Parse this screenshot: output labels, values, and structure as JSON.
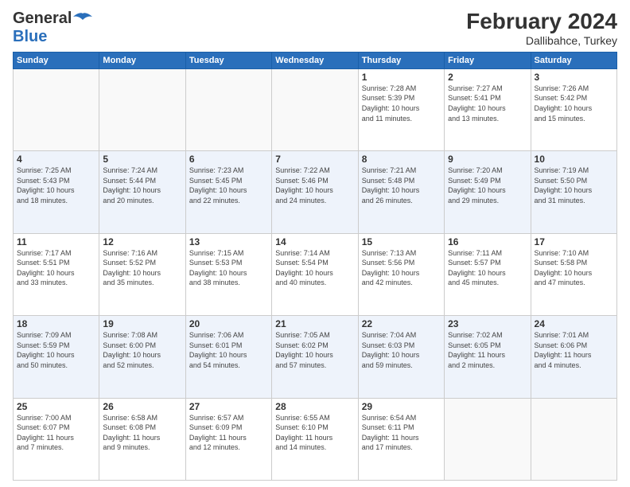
{
  "header": {
    "logo_general": "General",
    "logo_blue": "Blue",
    "month_year": "February 2024",
    "location": "Dallibahce, Turkey"
  },
  "days_of_week": [
    "Sunday",
    "Monday",
    "Tuesday",
    "Wednesday",
    "Thursday",
    "Friday",
    "Saturday"
  ],
  "weeks": [
    [
      {
        "day": "",
        "info": ""
      },
      {
        "day": "",
        "info": ""
      },
      {
        "day": "",
        "info": ""
      },
      {
        "day": "",
        "info": ""
      },
      {
        "day": "1",
        "info": "Sunrise: 7:28 AM\nSunset: 5:39 PM\nDaylight: 10 hours\nand 11 minutes."
      },
      {
        "day": "2",
        "info": "Sunrise: 7:27 AM\nSunset: 5:41 PM\nDaylight: 10 hours\nand 13 minutes."
      },
      {
        "day": "3",
        "info": "Sunrise: 7:26 AM\nSunset: 5:42 PM\nDaylight: 10 hours\nand 15 minutes."
      }
    ],
    [
      {
        "day": "4",
        "info": "Sunrise: 7:25 AM\nSunset: 5:43 PM\nDaylight: 10 hours\nand 18 minutes."
      },
      {
        "day": "5",
        "info": "Sunrise: 7:24 AM\nSunset: 5:44 PM\nDaylight: 10 hours\nand 20 minutes."
      },
      {
        "day": "6",
        "info": "Sunrise: 7:23 AM\nSunset: 5:45 PM\nDaylight: 10 hours\nand 22 minutes."
      },
      {
        "day": "7",
        "info": "Sunrise: 7:22 AM\nSunset: 5:46 PM\nDaylight: 10 hours\nand 24 minutes."
      },
      {
        "day": "8",
        "info": "Sunrise: 7:21 AM\nSunset: 5:48 PM\nDaylight: 10 hours\nand 26 minutes."
      },
      {
        "day": "9",
        "info": "Sunrise: 7:20 AM\nSunset: 5:49 PM\nDaylight: 10 hours\nand 29 minutes."
      },
      {
        "day": "10",
        "info": "Sunrise: 7:19 AM\nSunset: 5:50 PM\nDaylight: 10 hours\nand 31 minutes."
      }
    ],
    [
      {
        "day": "11",
        "info": "Sunrise: 7:17 AM\nSunset: 5:51 PM\nDaylight: 10 hours\nand 33 minutes."
      },
      {
        "day": "12",
        "info": "Sunrise: 7:16 AM\nSunset: 5:52 PM\nDaylight: 10 hours\nand 35 minutes."
      },
      {
        "day": "13",
        "info": "Sunrise: 7:15 AM\nSunset: 5:53 PM\nDaylight: 10 hours\nand 38 minutes."
      },
      {
        "day": "14",
        "info": "Sunrise: 7:14 AM\nSunset: 5:54 PM\nDaylight: 10 hours\nand 40 minutes."
      },
      {
        "day": "15",
        "info": "Sunrise: 7:13 AM\nSunset: 5:56 PM\nDaylight: 10 hours\nand 42 minutes."
      },
      {
        "day": "16",
        "info": "Sunrise: 7:11 AM\nSunset: 5:57 PM\nDaylight: 10 hours\nand 45 minutes."
      },
      {
        "day": "17",
        "info": "Sunrise: 7:10 AM\nSunset: 5:58 PM\nDaylight: 10 hours\nand 47 minutes."
      }
    ],
    [
      {
        "day": "18",
        "info": "Sunrise: 7:09 AM\nSunset: 5:59 PM\nDaylight: 10 hours\nand 50 minutes."
      },
      {
        "day": "19",
        "info": "Sunrise: 7:08 AM\nSunset: 6:00 PM\nDaylight: 10 hours\nand 52 minutes."
      },
      {
        "day": "20",
        "info": "Sunrise: 7:06 AM\nSunset: 6:01 PM\nDaylight: 10 hours\nand 54 minutes."
      },
      {
        "day": "21",
        "info": "Sunrise: 7:05 AM\nSunset: 6:02 PM\nDaylight: 10 hours\nand 57 minutes."
      },
      {
        "day": "22",
        "info": "Sunrise: 7:04 AM\nSunset: 6:03 PM\nDaylight: 10 hours\nand 59 minutes."
      },
      {
        "day": "23",
        "info": "Sunrise: 7:02 AM\nSunset: 6:05 PM\nDaylight: 11 hours\nand 2 minutes."
      },
      {
        "day": "24",
        "info": "Sunrise: 7:01 AM\nSunset: 6:06 PM\nDaylight: 11 hours\nand 4 minutes."
      }
    ],
    [
      {
        "day": "25",
        "info": "Sunrise: 7:00 AM\nSunset: 6:07 PM\nDaylight: 11 hours\nand 7 minutes."
      },
      {
        "day": "26",
        "info": "Sunrise: 6:58 AM\nSunset: 6:08 PM\nDaylight: 11 hours\nand 9 minutes."
      },
      {
        "day": "27",
        "info": "Sunrise: 6:57 AM\nSunset: 6:09 PM\nDaylight: 11 hours\nand 12 minutes."
      },
      {
        "day": "28",
        "info": "Sunrise: 6:55 AM\nSunset: 6:10 PM\nDaylight: 11 hours\nand 14 minutes."
      },
      {
        "day": "29",
        "info": "Sunrise: 6:54 AM\nSunset: 6:11 PM\nDaylight: 11 hours\nand 17 minutes."
      },
      {
        "day": "",
        "info": ""
      },
      {
        "day": "",
        "info": ""
      }
    ]
  ]
}
